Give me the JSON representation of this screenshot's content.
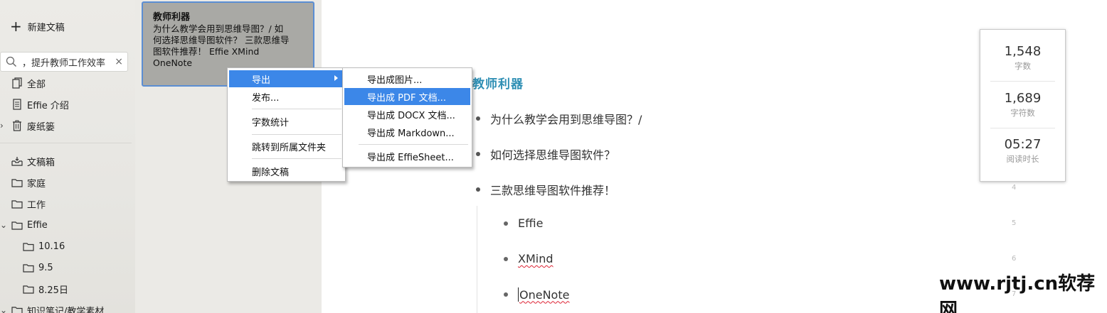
{
  "sidebar": {
    "new_doc_label": "新建文稿",
    "search_value": "，提升教师工作效率",
    "search_clear": "×",
    "top_items": [
      {
        "label": "全部"
      },
      {
        "label": "Effie 介绍"
      },
      {
        "label": "废纸篓"
      }
    ],
    "folders": [
      {
        "label": "文稿箱"
      },
      {
        "label": "家庭"
      },
      {
        "label": "工作"
      },
      {
        "label": "Effie"
      },
      {
        "label": "10.16"
      },
      {
        "label": "9.5"
      },
      {
        "label": "8.25日"
      },
      {
        "label": "知识笔记/教学素材"
      }
    ]
  },
  "doc_card": {
    "title": "教师利器",
    "snippet_lines": [
      "为什么教学会用到思维导图？/ 如",
      "何选择思维导图软件？  三款思维导",
      "图软件推荐！  Effie XMind",
      "OneNote"
    ]
  },
  "editor": {
    "heading": "教师利器",
    "bullets": [
      "为什么教学会用到思维导图？/",
      "如何选择思维导图软件？",
      "三款思维导图软件推荐！"
    ],
    "sub_bullets": [
      "Effie",
      "XMind",
      "OneNote"
    ],
    "line_numbers": [
      "4",
      "5",
      "6",
      "7"
    ]
  },
  "stats": {
    "words": {
      "value": "1,548",
      "label": "字数"
    },
    "chars": {
      "value": "1,689",
      "label": "字符数"
    },
    "reading": {
      "value": "05:27",
      "label": "阅读时长"
    }
  },
  "context_menu": {
    "items": [
      "导出",
      "发布...",
      "字数统计",
      "跳转到所属文件夹",
      "删除文稿"
    ]
  },
  "export_submenu": {
    "items": [
      "导出成图片...",
      "导出成 PDF 文档...",
      "导出成 DOCX 文档...",
      "导出成 Markdown...",
      "导出成 EffieSheet..."
    ]
  },
  "watermark": "www.rjtj.cn软荐网",
  "colors": {
    "heading": "#2f8fb4",
    "menu_highlight": "#3c87e8",
    "card_border": "#5b8ed3",
    "card_bg": "#a9a9a5"
  }
}
